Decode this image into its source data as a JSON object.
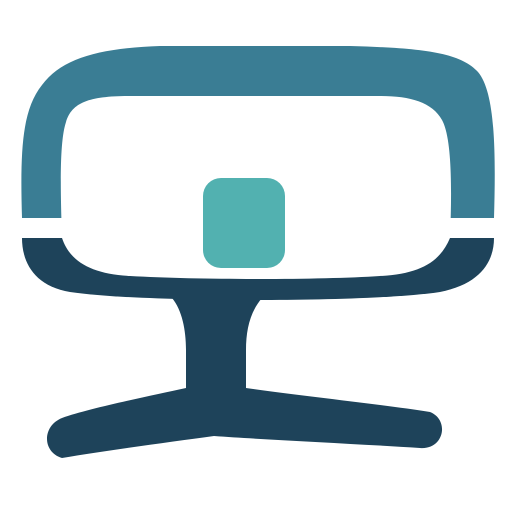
{
  "logo": {
    "name": "monitor-stand-icon",
    "colors": {
      "background": "#ffffff",
      "upper_band": "#3a7d94",
      "lower_band": "#1e435a",
      "center_square": "#52b1b0",
      "inner_screen": "#ffffff"
    }
  }
}
